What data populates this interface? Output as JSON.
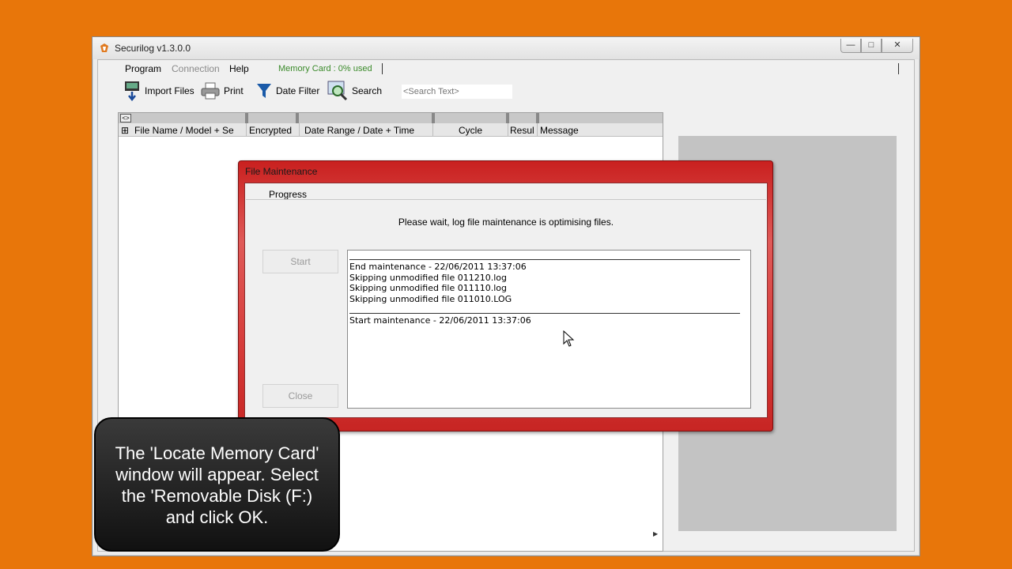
{
  "window": {
    "title": "Securilog  v1.3.0.0",
    "min": "—",
    "max": "□",
    "close": "✕"
  },
  "menu": {
    "program": "Program",
    "connection": "Connection",
    "help": "Help",
    "memory_card": "Memory Card : 0% used"
  },
  "toolbar": {
    "import": "Import Files",
    "print": "Print",
    "date_filter": "Date Filter",
    "search": "Search",
    "search_placeholder": "<Search Text>"
  },
  "file_list": {
    "toggle": "<>",
    "columns": [
      "File Name / Model + Se",
      "Encrypted",
      "Date Range / Date + Time",
      "Cycle",
      "Resul",
      "Message"
    ]
  },
  "dialog": {
    "title": "File Maintenance",
    "group": "Progress",
    "message": "Please wait, log file maintenance is optimising files.",
    "start": "Start",
    "close": "Close",
    "log": [
      "End maintenance - 22/06/2011 13:37:06",
      "Skipping unmodified file 011210.log",
      "Skipping unmodified file 011110.log",
      "Skipping unmodified file 011010.LOG",
      "Start maintenance - 22/06/2011 13:37:06"
    ]
  },
  "caption": {
    "lines": [
      "The 'Locate Memory Card'",
      "window will appear. Select",
      "the 'Removable Disk (F:)",
      "and click OK."
    ]
  },
  "colors": {
    "background": "#E8760A",
    "dialog_frame": "#D63B39",
    "memory_card_text": "#3A8A2A"
  }
}
